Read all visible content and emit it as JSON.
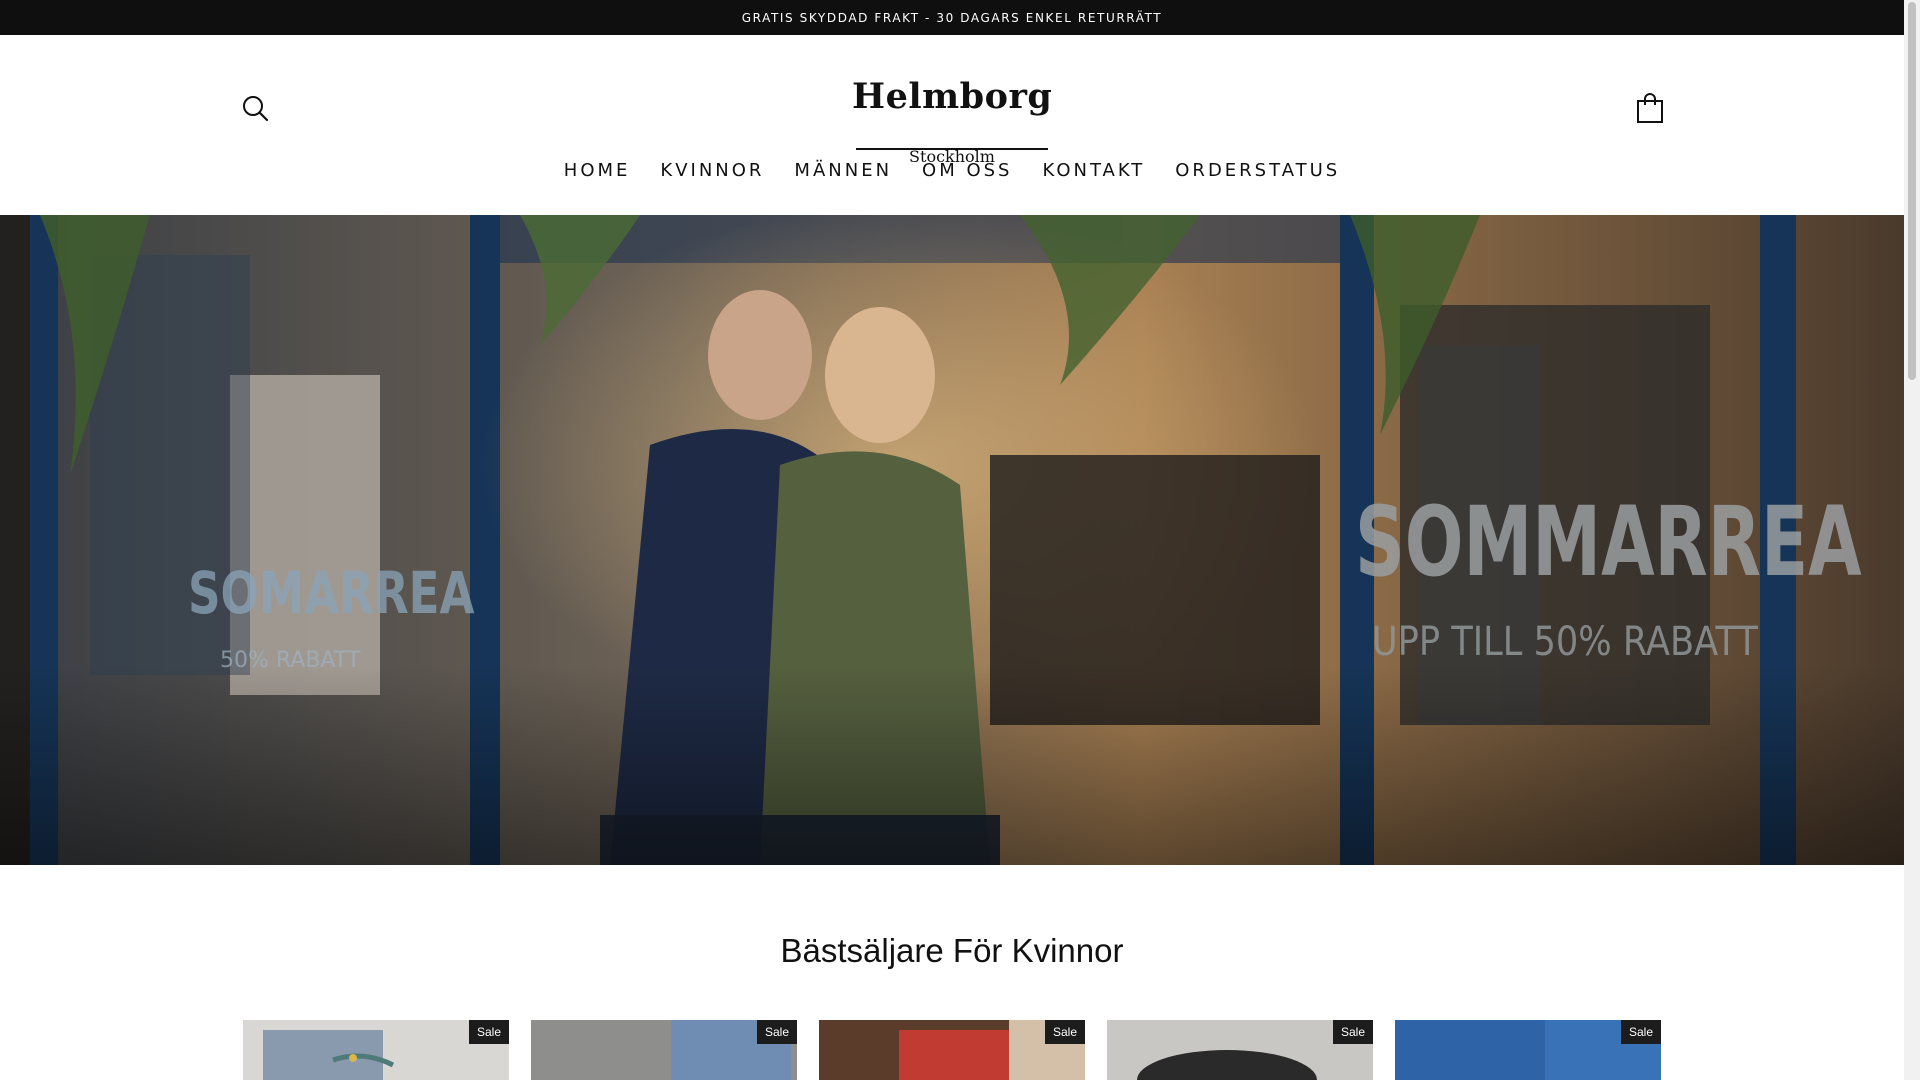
{
  "announcement": {
    "text": "GRATIS SKYDDAD FRAKT - 30 DAGARS ENKEL RETURRÄTT"
  },
  "header": {
    "logo_title": "Helmborg",
    "logo_subtitle": "Stockholm",
    "search_icon": "search-icon",
    "cart_icon": "shopping-bag-icon"
  },
  "nav": {
    "items": [
      {
        "label": "HOME"
      },
      {
        "label": "KVINNOR"
      },
      {
        "label": "MÄNNEN"
      },
      {
        "label": "OM OSS"
      },
      {
        "label": "KONTAKT"
      },
      {
        "label": "ORDERSTATUS"
      }
    ]
  },
  "hero": {
    "sign_left_title": "SOMARREA",
    "sign_left_sub": "50% RABATT",
    "sign_right_title": "SOMMARREA",
    "sign_right_sub": "UPP TILL 50%  RABATT"
  },
  "section": {
    "title": "Bästsäljare För Kvinnor",
    "products": [
      {
        "badge": "Sale"
      },
      {
        "badge": "Sale"
      },
      {
        "badge": "Sale"
      },
      {
        "badge": "Sale"
      },
      {
        "badge": "Sale"
      }
    ]
  },
  "colors": {
    "announcement_bg": "#0f0f0f",
    "text": "#111111",
    "badge_bg": "#1c1c1c"
  }
}
